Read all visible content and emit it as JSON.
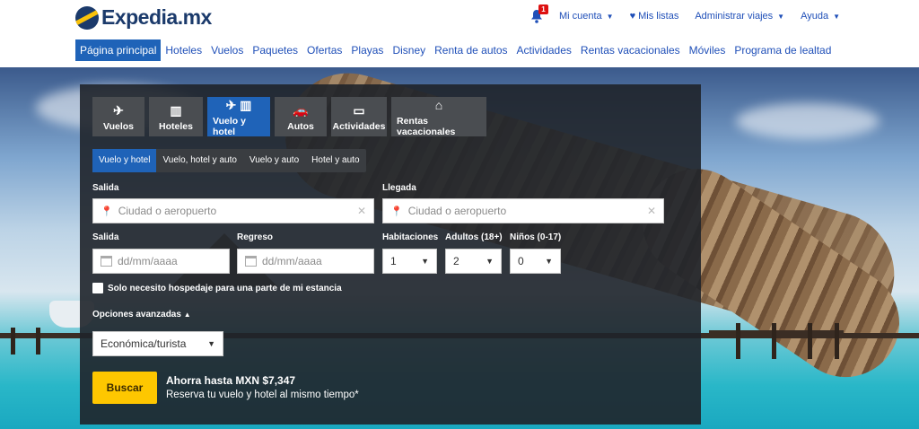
{
  "header": {
    "logo_text": "Expedia.mx",
    "notification_count": "1",
    "top_links": {
      "account": "Mi cuenta",
      "lists": "Mis listas",
      "trips": "Administrar viajes",
      "help": "Ayuda"
    },
    "main_nav": [
      "Página principal",
      "Hoteles",
      "Vuelos",
      "Paquetes",
      "Ofertas",
      "Playas",
      "Disney",
      "Renta de autos",
      "Actividades",
      "Rentas vacacionales",
      "Móviles",
      "Programa de lealtad"
    ],
    "active_nav_index": 0
  },
  "search": {
    "tabs": [
      "Vuelos",
      "Hoteles",
      "Vuelo y hotel",
      "Autos",
      "Actividades",
      "Rentas vacacionales"
    ],
    "tab_icons": [
      "plane-icon",
      "hotel-icon",
      "plane-hotel-icon",
      "car-icon",
      "ticket-icon",
      "house-icon"
    ],
    "active_tab_index": 2,
    "subtabs": [
      "Vuelo y hotel",
      "Vuelo, hotel y auto",
      "Vuelo y auto",
      "Hotel y auto"
    ],
    "active_subtab_index": 0,
    "origin": {
      "label": "Salida",
      "placeholder": "Ciudad o aeropuerto",
      "value": ""
    },
    "destination": {
      "label": "Llegada",
      "placeholder": "Ciudad o aeropuerto",
      "value": ""
    },
    "depart_date": {
      "label": "Salida",
      "placeholder": "dd/mm/aaaa"
    },
    "return_date": {
      "label": "Regreso",
      "placeholder": "dd/mm/aaaa"
    },
    "rooms": {
      "label": "Habitaciones",
      "value": "1"
    },
    "adults": {
      "label": "Adultos (18+)",
      "value": "2"
    },
    "children": {
      "label": "Niños (0-17)",
      "value": "0"
    },
    "partial_stay_label": "Solo necesito hospedaje para una parte de mi estancia",
    "advanced_label": "Opciones avanzadas",
    "cabin_class": "Económica/turista",
    "search_button": "Buscar",
    "promo_title": "Ahorra hasta MXN $7,347",
    "promo_subtitle": "Reserva tu vuelo y hotel al mismo tiempo*"
  },
  "colors": {
    "brand": "#1b3a6b",
    "link": "#1f4fb8",
    "active": "#1f63b8",
    "search_button": "#fec700"
  }
}
